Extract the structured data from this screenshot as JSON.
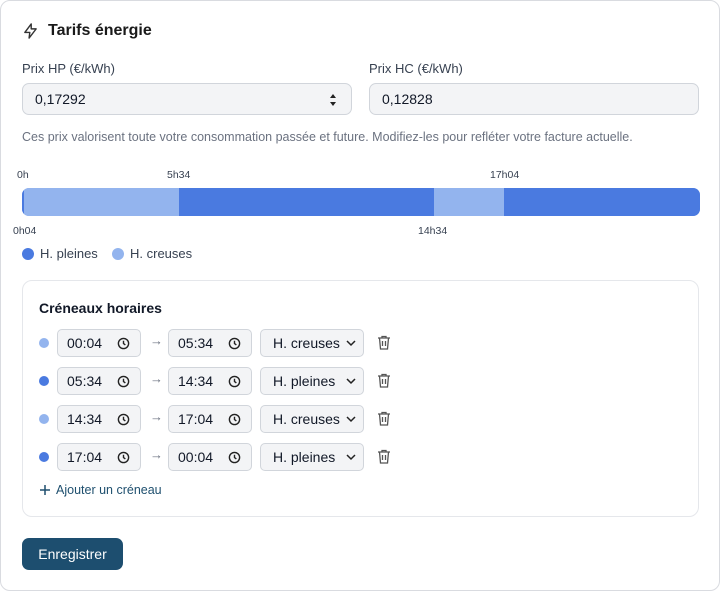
{
  "header": {
    "title": "Tarifs énergie",
    "icon": "lightning-icon"
  },
  "hp": {
    "label": "Prix HP (€/kWh)",
    "value": "0,17292"
  },
  "hc": {
    "label": "Prix HC (€/kWh)",
    "value": "0,12828"
  },
  "hint": "Ces prix valorisent toute votre consommation passée et future. Modifiez-les pour refléter votre facture actuelle.",
  "colors": {
    "pleines": "#4a7ae0",
    "creuses": "#93b4ee",
    "accent": "#1d4e6f"
  },
  "timeline": {
    "ticks_top": [
      "0h",
      "5h34",
      "17h04"
    ],
    "ticks_bottom": [
      "0h04",
      "14h34"
    ],
    "segments": [
      {
        "start_min": 4,
        "end_min": 334,
        "type": "creuses"
      },
      {
        "start_min": 334,
        "end_min": 874,
        "type": "pleines"
      },
      {
        "start_min": 874,
        "end_min": 1024,
        "type": "creuses"
      },
      {
        "start_min": 1024,
        "end_min": 1440,
        "type": "pleines"
      },
      {
        "start_min": 0,
        "end_min": 4,
        "type": "pleines"
      }
    ]
  },
  "legend": {
    "pleines": "H. pleines",
    "creuses": "H. creuses"
  },
  "slots": {
    "title": "Créneaux horaires",
    "rows": [
      {
        "start": "00:04",
        "end": "05:34",
        "type": "creuses",
        "type_label": "H. creuses"
      },
      {
        "start": "05:34",
        "end": "14:34",
        "type": "pleines",
        "type_label": "H. pleines"
      },
      {
        "start": "14:34",
        "end": "17:04",
        "type": "creuses",
        "type_label": "H. creuses"
      },
      {
        "start": "17:04",
        "end": "00:04",
        "type": "pleines",
        "type_label": "H. pleines"
      }
    ],
    "add_label": "Ajouter un créneau"
  },
  "save_label": "Enregistrer"
}
